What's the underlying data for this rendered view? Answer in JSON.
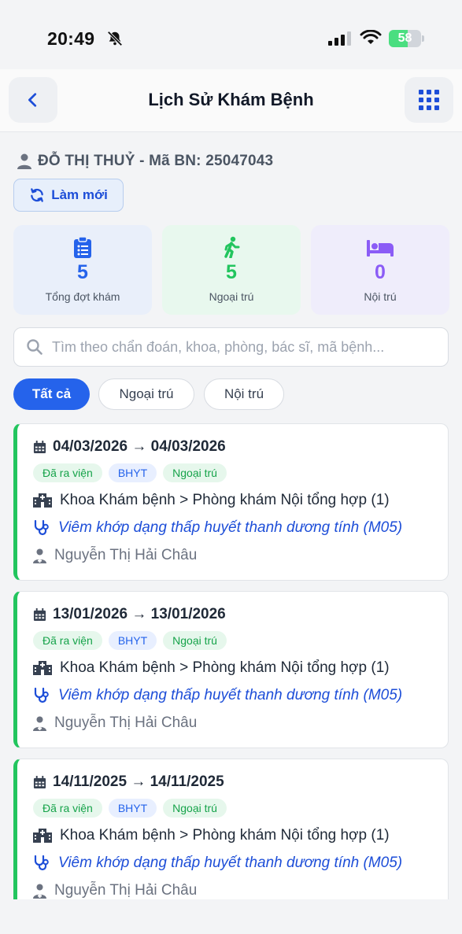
{
  "status_bar": {
    "time": "20:49",
    "battery": "58",
    "battery_level": 0.58
  },
  "header": {
    "title": "Lịch Sử Khám Bệnh"
  },
  "patient": {
    "info": "ĐỖ THỊ THUỶ - Mã BN: 25047043"
  },
  "refresh_label": "Làm mới",
  "stats": [
    {
      "value": "5",
      "label": "Tổng đợt khám",
      "color": "#2563eb"
    },
    {
      "value": "5",
      "label": "Ngoại trú",
      "color": "#22c55e"
    },
    {
      "value": "0",
      "label": "Nội trú",
      "color": "#8b5cf6"
    }
  ],
  "search": {
    "placeholder": "Tìm theo chẩn đoán, khoa, phòng, bác sĩ, mã bệnh..."
  },
  "filters": [
    "Tất cả",
    "Ngoại trú",
    "Nội trú"
  ],
  "visits": [
    {
      "dates": "04/03/2026 → 04/03/2026",
      "badges": [
        "Đã ra viện",
        "BHYT",
        "Ngoại trú"
      ],
      "department": "Khoa Khám bệnh > Phòng khám Nội tổng hợp (1)",
      "diagnosis": "Viêm khớp dạng thấp huyết thanh dương tính (M05)",
      "doctor": "Nguyễn Thị Hải Châu"
    },
    {
      "dates": "13/01/2026 → 13/01/2026",
      "badges": [
        "Đã ra viện",
        "BHYT",
        "Ngoại trú"
      ],
      "department": "Khoa Khám bệnh > Phòng khám Nội tổng hợp (1)",
      "diagnosis": "Viêm khớp dạng thấp huyết thanh dương tính (M05)",
      "doctor": "Nguyễn Thị Hải Châu"
    },
    {
      "dates": "14/11/2025 → 14/11/2025",
      "badges": [
        "Đã ra viện",
        "BHYT",
        "Ngoại trú"
      ],
      "department": "Khoa Khám bệnh > Phòng khám Nội tổng hợp (1)",
      "diagnosis": "Viêm khớp dạng thấp huyết thanh dương tính (M05)",
      "doctor": "Nguyễn Thị Hải Châu"
    }
  ],
  "colors": {
    "accent": "#2563eb",
    "outpatient": "#22c55e",
    "inpatient": "#8b5cf6"
  }
}
